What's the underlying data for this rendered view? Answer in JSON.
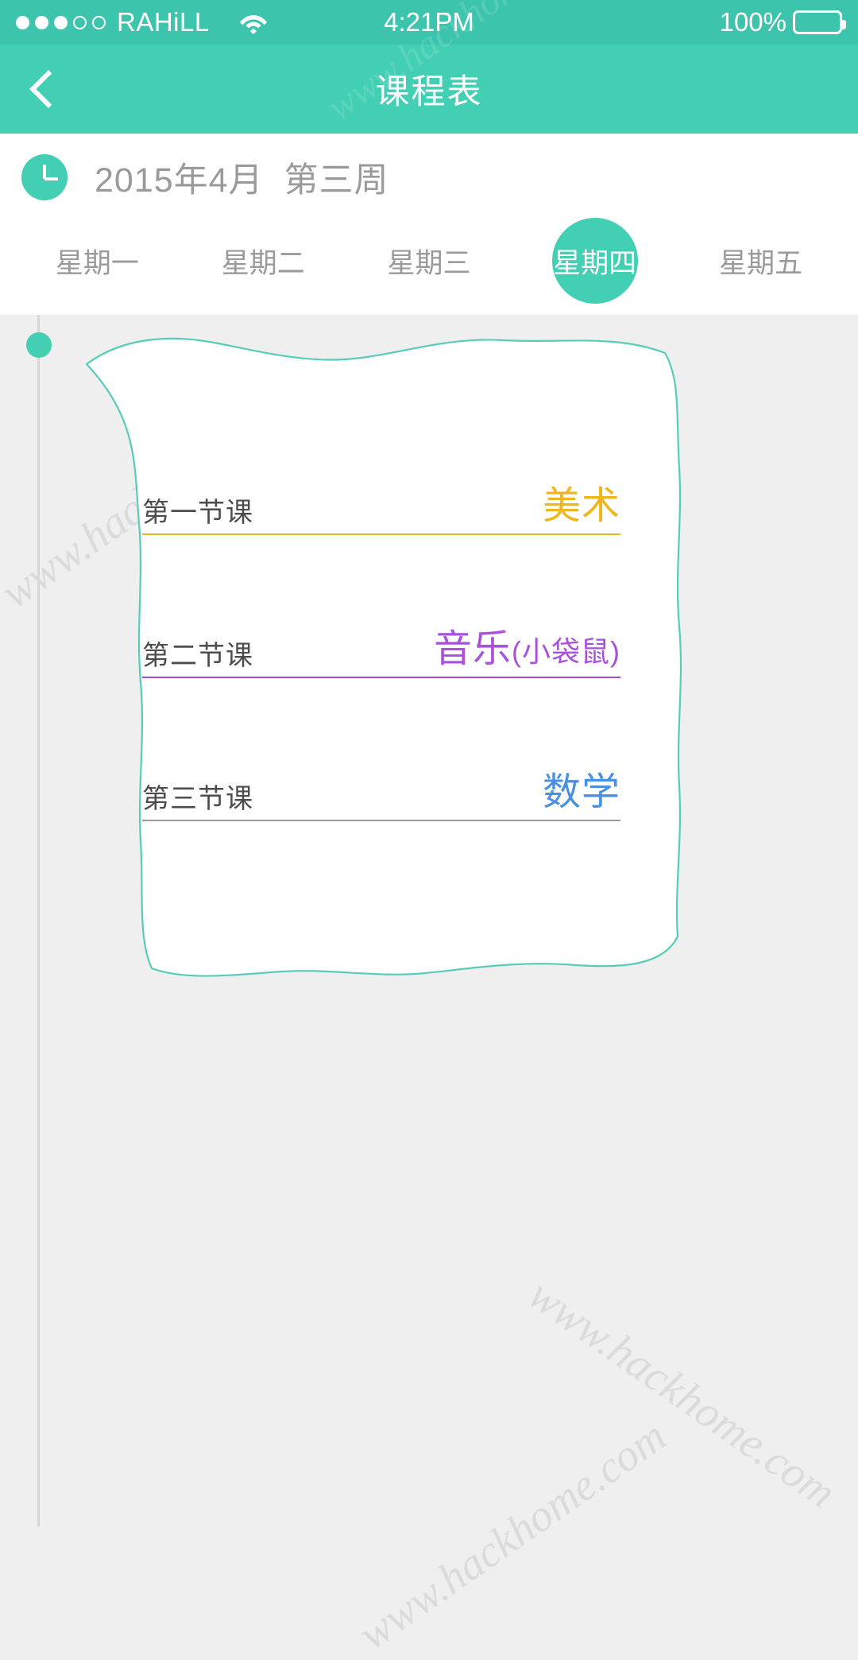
{
  "status_bar": {
    "carrier": "RAHiLL",
    "signal_dots_total": 5,
    "signal_dots_filled": 3,
    "wifi_icon": "wifi-icon",
    "time": "4:21PM",
    "battery_percent": "100%",
    "background_color": "#3cc5ac"
  },
  "nav_bar": {
    "back_icon": "chevron-left-icon",
    "title": "课程表",
    "background_color": "#42cfb3"
  },
  "week_header": {
    "clock_icon": "clock-icon",
    "date_label": "2015年4月  第三周",
    "accent_color": "#42cfb3",
    "tabs": [
      {
        "label": "星期一",
        "active": false
      },
      {
        "label": "星期二",
        "active": false
      },
      {
        "label": "星期三",
        "active": false
      },
      {
        "label": "星期四",
        "active": true
      },
      {
        "label": "星期五",
        "active": false
      }
    ]
  },
  "schedule_card": {
    "border_color": "#57ccb8",
    "lessons": [
      {
        "period": "第一节课",
        "subject": "美术",
        "subject_suffix": "",
        "color": "#f0b71c"
      },
      {
        "period": "第二节课",
        "subject": "音乐",
        "subject_suffix": "(小袋鼠)",
        "color": "#a851dd"
      },
      {
        "period": "第三节课",
        "subject": "数学",
        "subject_suffix": "",
        "color": "#4a90e2"
      }
    ]
  },
  "watermark": {
    "text": "www.hackhome.com"
  }
}
